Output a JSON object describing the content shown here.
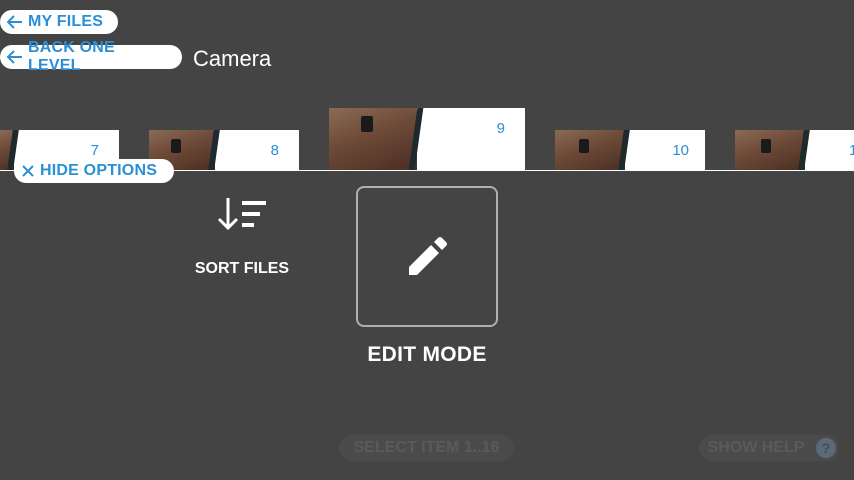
{
  "nav": {
    "my_files": "MY FILES",
    "back_one_level": "BACK ONE LEVEL",
    "folder_name": "Camera"
  },
  "thumbnails": [
    {
      "label": "7"
    },
    {
      "label": "8"
    },
    {
      "label": "9"
    },
    {
      "label": "10"
    },
    {
      "label": "1"
    }
  ],
  "options": {
    "hide_options": "HIDE OPTIONS",
    "sort_files": "SORT FILES",
    "edit_mode": "EDIT MODE"
  },
  "footer": {
    "select_item": "SELECT ITEM 1..16",
    "show_help": "SHOW HELP",
    "help_icon": "?"
  },
  "colors": {
    "background": "#444444",
    "accent": "#2a8fd6",
    "pill_bg": "#ffffff"
  }
}
